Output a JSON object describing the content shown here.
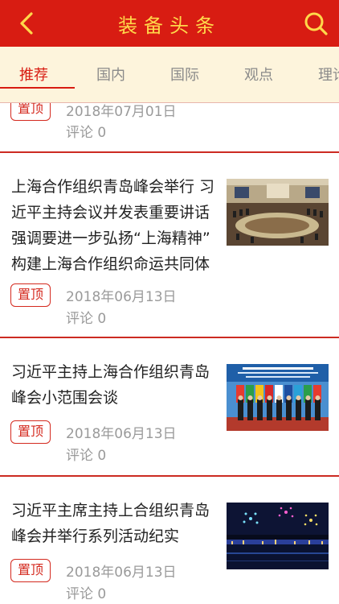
{
  "header": {
    "title": "装备头条",
    "back_icon": "chevron-left-icon",
    "search_icon": "search-icon",
    "bg_color": "#d81c12",
    "title_color": "#ffd84a"
  },
  "tabs": [
    {
      "label": "推荐",
      "active": true
    },
    {
      "label": "国内",
      "active": false
    },
    {
      "label": "国际",
      "active": false
    },
    {
      "label": "观点",
      "active": false
    },
    {
      "label": "理论",
      "active": false
    }
  ],
  "articles": [
    {
      "title": "",
      "badge": "置顶",
      "date": "2018年07月01日",
      "comments": "评论 0",
      "has_image": false
    },
    {
      "title": "上海合作组织青岛峰会举行 习近平主持会议并发表重要讲话 强调要进一步弘扬“上海精神” 构建上海合作组织命运共同体",
      "badge": "置顶",
      "date": "2018年06月13日",
      "comments": "评论 0",
      "has_image": true,
      "image_desc": "conference-hall-photo"
    },
    {
      "title": "习近平主持上海合作组织青岛峰会小范围会谈",
      "badge": "置顶",
      "date": "2018年06月13日",
      "comments": "评论 0",
      "has_image": true,
      "image_desc": "group-photo"
    },
    {
      "title": "习近平主席主持上合组织青岛峰会并举行系列活动纪实",
      "badge": "置顶",
      "date": "2018年06月13日",
      "comments": "评论 0",
      "has_image": true,
      "image_desc": "fireworks-night-photo"
    }
  ]
}
